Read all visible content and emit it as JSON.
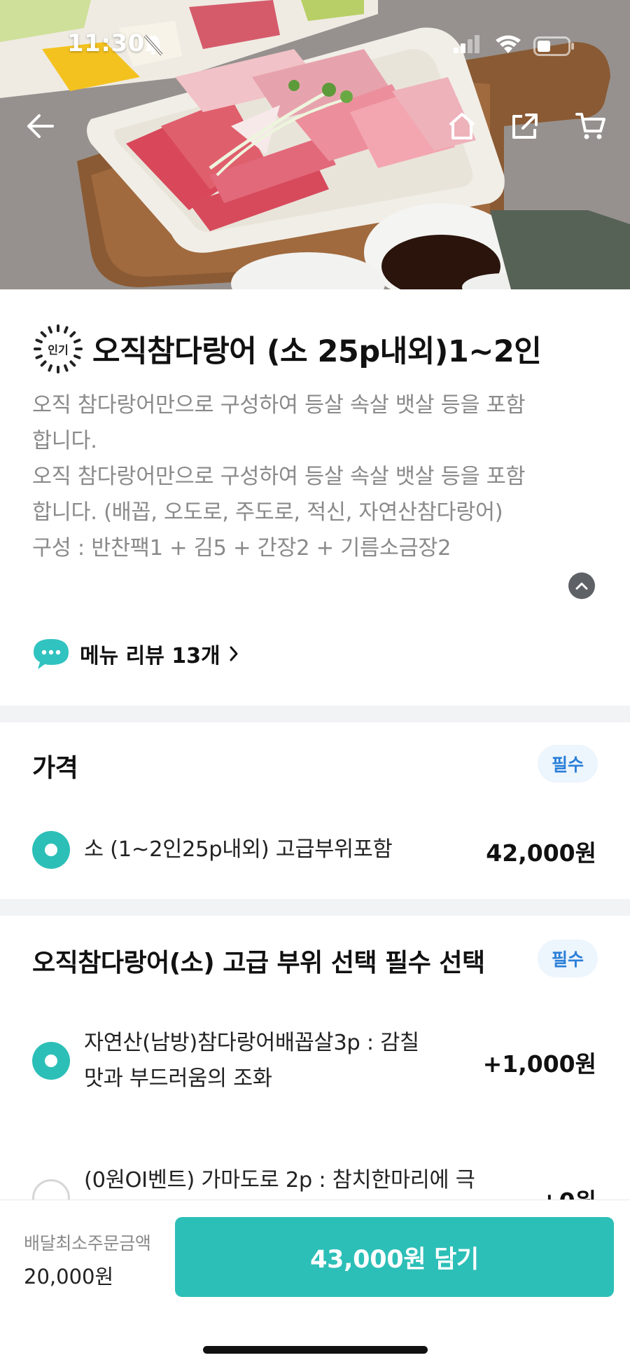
{
  "status_bar": {
    "time": "11:30"
  },
  "product": {
    "badge": "인기",
    "title": "오직참다랑어  (소 25p내외)1~2인",
    "description_lines": [
      "오직 참다랑어만으로 구성하여 등살 속살 뱃살 등을 포함",
      "합니다.",
      "오직 참다랑어만으로 구성하여 등살 속살 뱃살 등을 포함",
      "합니다. (배꼽, 오도로, 주도로, 적신, 자연산참다랑어)",
      "구성 : 반찬팩1 + 김5 + 간장2 + 기름소금장2"
    ],
    "review_label": "메뉴 리뷰 13개"
  },
  "price_section": {
    "title": "가격",
    "badge": "필수",
    "option": {
      "label": "소 (1~2인25p내외) 고급부위포함",
      "price": "42,000원",
      "selected": true
    }
  },
  "grade_section": {
    "title": "오직참다랑어(소) 고급 부위 선택 필수 선택",
    "badge": "필수",
    "options": [
      {
        "line1": "자연산(남방)참다랑어배꼽살3p : 감칠",
        "line2": "맛과 부드러움의 조화",
        "price": "+1,000원",
        "selected": true
      },
      {
        "line1": "(0원OI벤트) 가마도로 2p : 참치한마리에 극",
        "line2": "",
        "price": "+0원",
        "selected": false
      }
    ]
  },
  "bottom_bar": {
    "min_order_label": "배달최소주문금액",
    "min_order_value": "20,000원",
    "cta_label": "43,000원 담기"
  },
  "colors": {
    "accent": "#2cbfb7",
    "badge_bg": "#edf5fd",
    "badge_text": "#2b7fd8",
    "muted_text": "#8a8a8a"
  }
}
